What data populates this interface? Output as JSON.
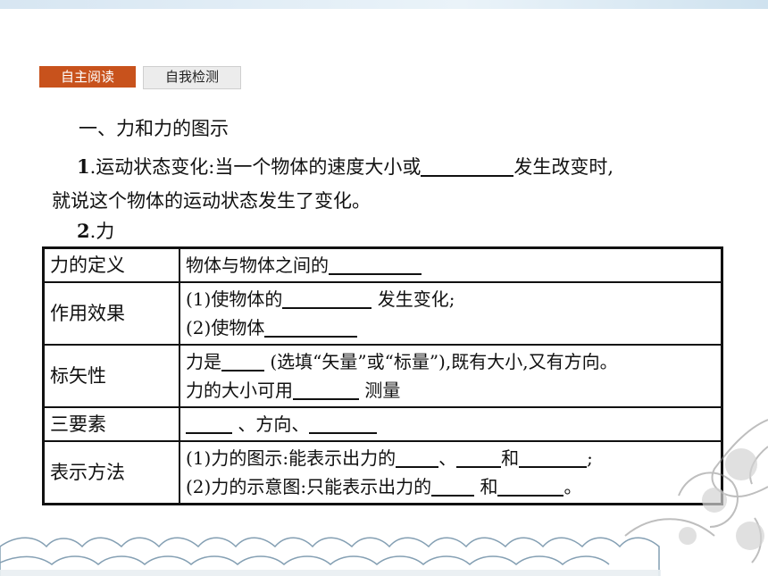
{
  "tabs": [
    "自主阅读",
    "自我检测"
  ],
  "heading": "一、力和力的图示",
  "item1": {
    "num": "1",
    "text_a": ".运动状态变化:当一个物体的速度大小或",
    "text_b": "发生改变时,",
    "text_c": "就说这个物体的运动状态发生了变化。"
  },
  "item2": {
    "num": "2",
    "text": ".力"
  },
  "table": {
    "row1": {
      "head": "力的定义",
      "a": "物体与物体之间的"
    },
    "row2": {
      "head": "作用效果",
      "a": "(1)使物体的",
      "b": "发生变化;",
      "c": "(2)使物体"
    },
    "row3": {
      "head": "标矢性",
      "a": "力是",
      "b": "(选填“矢量”或“标量”),既有大小,又有方向。",
      "c": "力的大小可用",
      "d": "测量"
    },
    "row4": {
      "head": "三要素",
      "a": "、方向、"
    },
    "row5": {
      "head": "表示方法",
      "a": "(1)力的图示:能表示出力的",
      "b": "、",
      "c": "和",
      "d": ";",
      "e": "(2)力的示意图:只能表示出力的",
      "f": "和",
      "g": "。"
    }
  }
}
